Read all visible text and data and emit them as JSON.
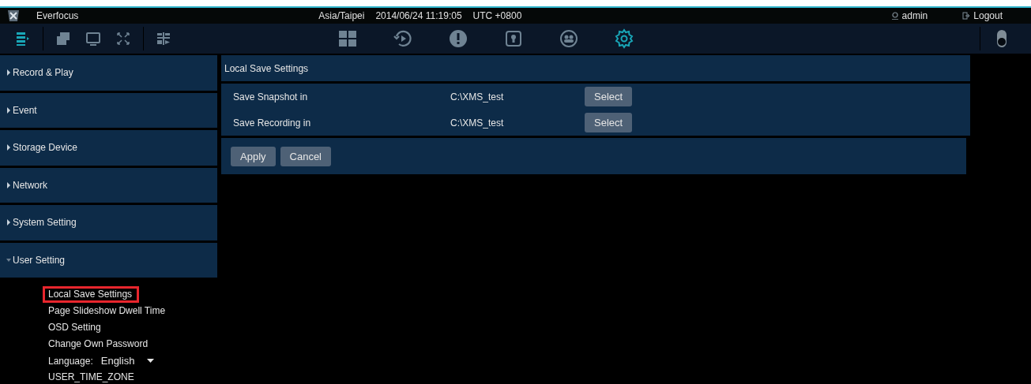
{
  "title_bar": {
    "app_name": "Everfocus",
    "timezone": "Asia/Taipei",
    "datetime": "2014/06/24 11:19:05",
    "utc_offset": "UTC +0800",
    "user": "admin",
    "logout": "Logout"
  },
  "toolbar": {
    "left_tools": [
      {
        "kind": "menu",
        "selected": true
      },
      {
        "kind": "windows",
        "selected": false
      },
      {
        "kind": "monitor",
        "selected": false
      },
      {
        "kind": "fullscreen",
        "selected": false
      },
      {
        "kind": "layout",
        "selected": false
      }
    ],
    "center_tools": [
      {
        "kind": "grid",
        "selected": false
      },
      {
        "kind": "playback",
        "selected": false
      },
      {
        "kind": "alert",
        "selected": false
      },
      {
        "kind": "lock",
        "selected": false
      },
      {
        "kind": "group",
        "selected": false
      },
      {
        "kind": "gear",
        "selected": true
      }
    ]
  },
  "sidebar": {
    "sections": [
      {
        "label": "Record & Play",
        "expanded": false
      },
      {
        "label": "Event",
        "expanded": false
      },
      {
        "label": "Storage Device",
        "expanded": false
      },
      {
        "label": "Network",
        "expanded": false
      },
      {
        "label": "System Setting",
        "expanded": false
      },
      {
        "label": "User Setting",
        "expanded": true,
        "children": [
          {
            "kind": "link",
            "label": "Local Save Settings",
            "selected": true
          },
          {
            "kind": "link",
            "label": "Page Slideshow Dwell Time",
            "selected": false
          },
          {
            "kind": "link",
            "label": "OSD Setting",
            "selected": false
          },
          {
            "kind": "link",
            "label": "Change Own Password",
            "selected": false
          },
          {
            "kind": "dropdown",
            "label": "Language:",
            "value": "English"
          },
          {
            "kind": "link",
            "label": "USER_TIME_ZONE",
            "selected": false
          }
        ]
      }
    ]
  },
  "panel": {
    "title": "Local Save Settings",
    "rows": [
      {
        "label": "Save Snapshot in",
        "path": "C:\\XMS_test",
        "button": "Select"
      },
      {
        "label": "Save Recording in",
        "path": "C:\\XMS_test",
        "button": "Select"
      }
    ],
    "buttons": [
      "Apply",
      "Cancel"
    ]
  }
}
